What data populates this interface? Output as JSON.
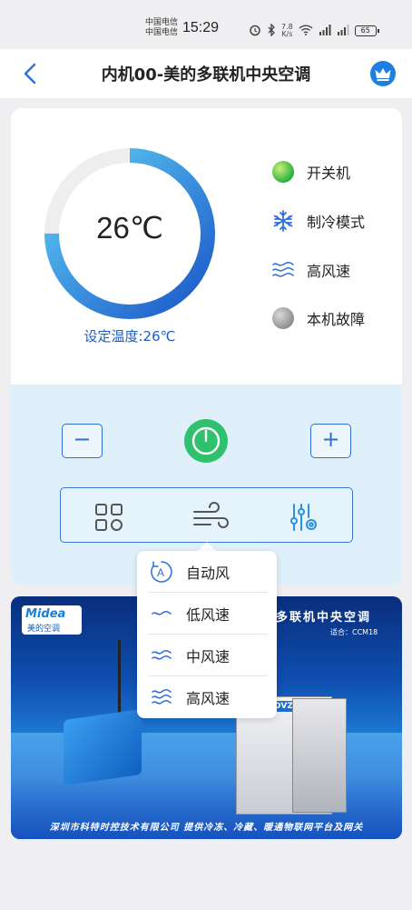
{
  "status_bar": {
    "carrier_1": "中国电信",
    "carrier_2": "中国电信",
    "time": "15:29",
    "net_speed_value": "7.8",
    "net_speed_unit": "K/s",
    "battery": "65"
  },
  "header": {
    "title": "内机00-美的多联机中央空调"
  },
  "thermostat": {
    "current_temp": "26℃",
    "set_temp_label": "设定温度:26℃",
    "gauge_fill_fraction": 0.75
  },
  "status_list": [
    {
      "label": "开关机",
      "icon": "power-status-dot-icon",
      "color": "#4cbf3a"
    },
    {
      "label": "制冷模式",
      "icon": "snowflake-icon",
      "color": "#2d6fd8"
    },
    {
      "label": "高风速",
      "icon": "wind-high-icon",
      "color": "#2d6fd8"
    },
    {
      "label": "本机故障",
      "icon": "fault-status-dot-icon",
      "color": "#9a9a9a"
    }
  ],
  "controls": {
    "minus_label": "−",
    "plus_label": "+"
  },
  "fan_popup": {
    "items": [
      {
        "label": "自动风",
        "icon": "auto-wind-icon"
      },
      {
        "label": "低风速",
        "icon": "wind-low-icon"
      },
      {
        "label": "中风速",
        "icon": "wind-medium-icon"
      },
      {
        "label": "高风速",
        "icon": "wind-high-icon"
      }
    ]
  },
  "banner": {
    "brand": "Midea",
    "brand_sub": "美的空调",
    "title": "多联机中央空调",
    "subtitle": "适合：CCM18",
    "unit_logo": "MDVZ",
    "footer": "深圳市科特时控技术有限公司 提供冷冻、冷藏、暖通物联网平台及网关"
  },
  "colors": {
    "accent": "#2d6fd8",
    "power_green": "#2fc16d",
    "gauge_start": "#1a56c8",
    "gauge_end": "#5fd0f5",
    "gauge_track": "#eeeeee"
  }
}
